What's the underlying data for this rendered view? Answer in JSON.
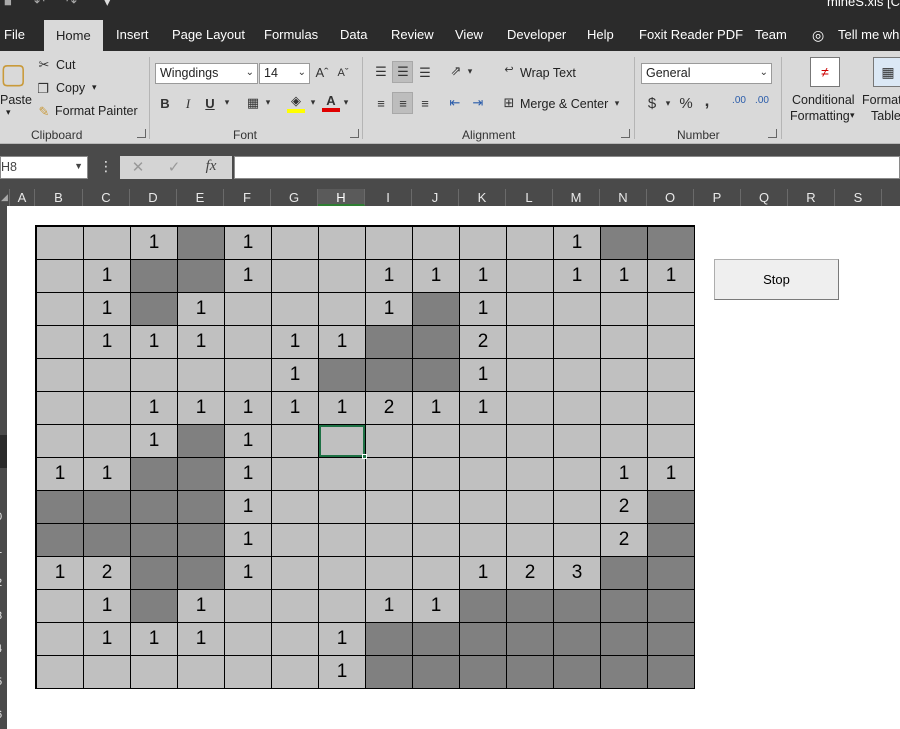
{
  "window": {
    "filename": "mineS.xls [C"
  },
  "menu": {
    "tabs": [
      "File",
      "Home",
      "Insert",
      "Page Layout",
      "Formulas",
      "Data",
      "Review",
      "View",
      "Developer",
      "Help",
      "Foxit Reader PDF",
      "Team"
    ],
    "tell_me": "Tell me wha"
  },
  "clipboard": {
    "paste": "Paste",
    "cut": "Cut",
    "copy": "Copy",
    "format_painter": "Format Painter",
    "group": "Clipboard"
  },
  "font": {
    "name": "Wingdings",
    "size": "14",
    "bold": "B",
    "italic": "I",
    "underline": "U",
    "group": "Font"
  },
  "alignment": {
    "wrap_text": "Wrap Text",
    "merge_center": "Merge & Center",
    "group": "Alignment"
  },
  "number": {
    "format": "General",
    "currency": "$",
    "percent": "%",
    "comma": ",",
    "inc_decimal": ".00",
    "dec_decimal": ".00",
    "group": "Number"
  },
  "styles": {
    "conditional_line1": "Conditional",
    "conditional_line2": "Formatting",
    "format_line1": "Format",
    "format_line2": "Table"
  },
  "formula_bar": {
    "name_box": "H8",
    "formula": ""
  },
  "columns": [
    "A",
    "B",
    "C",
    "D",
    "E",
    "F",
    "G",
    "H",
    "I",
    "J",
    "K",
    "L",
    "M",
    "N",
    "O",
    "P",
    "Q",
    "R",
    "S"
  ],
  "selected_column": "H",
  "rows": [
    "",
    "",
    "",
    "",
    "",
    "",
    "",
    "",
    "",
    "0",
    "1",
    "2",
    "3",
    "4",
    "5",
    "6"
  ],
  "board": {
    "cols": 14,
    "rows": [
      [
        "",
        "",
        "1",
        "#",
        "1",
        "",
        "",
        "",
        "",
        "",
        "",
        "1",
        "#",
        "#"
      ],
      [
        "",
        "1",
        "#",
        "#",
        "1",
        "",
        "",
        "1",
        "1",
        "1",
        "",
        "1",
        "1",
        "1"
      ],
      [
        "",
        "1",
        "#",
        "1",
        "",
        "",
        "",
        "1",
        "#",
        "1",
        "",
        "",
        "",
        ""
      ],
      [
        "",
        "1",
        "1",
        "1",
        "",
        "1",
        "1",
        "#",
        "#",
        "2",
        "",
        "",
        "",
        ""
      ],
      [
        "",
        "",
        "",
        "",
        "",
        "1",
        "#",
        "#",
        "#",
        "1",
        "",
        "",
        "",
        ""
      ],
      [
        "",
        "",
        "1",
        "1",
        "1",
        "1",
        "1",
        "2",
        "1",
        "1",
        "",
        "",
        "",
        ""
      ],
      [
        "",
        "",
        "1",
        "#",
        "1",
        "",
        "",
        "",
        "",
        "",
        "",
        "",
        "",
        ""
      ],
      [
        "1",
        "1",
        "#",
        "#",
        "1",
        "",
        "",
        "",
        "",
        "",
        "",
        "",
        "1",
        "1"
      ],
      [
        "#",
        "#",
        "#",
        "#",
        "1",
        "",
        "",
        "",
        "",
        "",
        "",
        "",
        "2",
        "#"
      ],
      [
        "#",
        "#",
        "#",
        "#",
        "1",
        "",
        "",
        "",
        "",
        "",
        "",
        "",
        "2",
        "#"
      ],
      [
        "1",
        "2",
        "#",
        "#",
        "1",
        "",
        "",
        "",
        "",
        "1",
        "2",
        "3",
        "#",
        "#"
      ],
      [
        "",
        "1",
        "#",
        "1",
        "",
        "",
        "",
        "1",
        "1",
        "#",
        "#",
        "#",
        "#",
        "#"
      ],
      [
        "",
        "1",
        "1",
        "1",
        "",
        "",
        "1",
        "#",
        "#",
        "#",
        "#",
        "#",
        "#",
        "#"
      ],
      [
        "",
        "",
        "",
        "",
        "",
        "",
        "1",
        "#",
        "#",
        "#",
        "#",
        "#",
        "#",
        "#"
      ]
    ],
    "active_row": 6,
    "active_col": 6
  },
  "stop_button": {
    "label": "Stop"
  },
  "colors": {
    "revealed": "#c0c0c0",
    "hidden": "#808080",
    "selection": "#1e7145"
  }
}
